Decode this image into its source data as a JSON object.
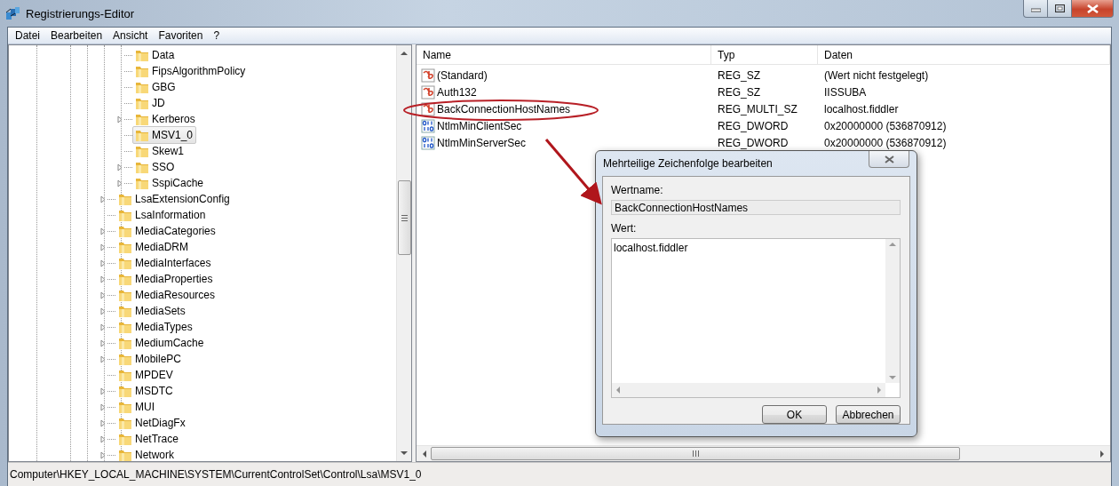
{
  "window": {
    "title": "Registrierungs-Editor"
  },
  "menu": [
    {
      "label": "Datei"
    },
    {
      "label": "Bearbeiten"
    },
    {
      "label": "Ansicht"
    },
    {
      "label": "Favoriten"
    },
    {
      "label": "?"
    }
  ],
  "tree": [
    {
      "children": [
        {
          "name": "Data",
          "expandable": false,
          "selected": false
        },
        {
          "name": "FipsAlgorithmPolicy",
          "expandable": false,
          "selected": false
        },
        {
          "name": "GBG",
          "expandable": false,
          "selected": false
        },
        {
          "name": "JD",
          "expandable": false,
          "selected": false
        },
        {
          "name": "Kerberos",
          "expandable": true,
          "selected": false
        },
        {
          "name": "MSV1_0",
          "expandable": false,
          "selected": true
        },
        {
          "name": "Skew1",
          "expandable": false,
          "selected": false
        },
        {
          "name": "SSO",
          "expandable": true,
          "selected": false
        },
        {
          "name": "SspiCache",
          "expandable": true,
          "selected": false
        }
      ]
    },
    {
      "name": "LsaExtensionConfig",
      "expandable": true,
      "selected": false
    },
    {
      "name": "LsaInformation",
      "expandable": false,
      "selected": false
    },
    {
      "name": "MediaCategories",
      "expandable": true,
      "selected": false
    },
    {
      "name": "MediaDRM",
      "expandable": true,
      "selected": false
    },
    {
      "name": "MediaInterfaces",
      "expandable": true,
      "selected": false
    },
    {
      "name": "MediaProperties",
      "expandable": true,
      "selected": false
    },
    {
      "name": "MediaResources",
      "expandable": true,
      "selected": false
    },
    {
      "name": "MediaSets",
      "expandable": true,
      "selected": false
    },
    {
      "name": "MediaTypes",
      "expandable": true,
      "selected": false
    },
    {
      "name": "MediumCache",
      "expandable": true,
      "selected": false
    },
    {
      "name": "MobilePC",
      "expandable": true,
      "selected": false
    },
    {
      "name": "MPDEV",
      "expandable": false,
      "selected": false
    },
    {
      "name": "MSDTC",
      "expandable": true,
      "selected": false
    },
    {
      "name": "MUI",
      "expandable": true,
      "selected": false
    },
    {
      "name": "NetDiagFx",
      "expandable": true,
      "selected": false
    },
    {
      "name": "NetTrace",
      "expandable": true,
      "selected": false
    },
    {
      "name": "Network",
      "expandable": true,
      "selected": false
    }
  ],
  "table": {
    "columns": [
      "Name",
      "Typ",
      "Daten"
    ],
    "rows": [
      {
        "kind": "string",
        "name": "(Standard)",
        "type": "REG_SZ",
        "data": "(Wert nicht festgelegt)"
      },
      {
        "kind": "string",
        "name": "Auth132",
        "type": "REG_SZ",
        "data": "IISSUBA"
      },
      {
        "kind": "string",
        "name": "BackConnectionHostNames",
        "type": "REG_MULTI_SZ",
        "data": "localhost.fiddler"
      },
      {
        "kind": "binary",
        "name": "NtlmMinClientSec",
        "type": "REG_DWORD",
        "data": "0x20000000 (536870912)"
      },
      {
        "kind": "binary",
        "name": "NtlmMinServerSec",
        "type": "REG_DWORD",
        "data": "0x20000000 (536870912)"
      }
    ]
  },
  "dialog": {
    "title": "Mehrteilige Zeichenfolge bearbeiten",
    "name_label": "Wertname:",
    "name_value": "BackConnectionHostNames",
    "value_label": "Wert:",
    "value": "localhost.fiddler",
    "buttons": [
      "OK",
      "Abbrechen"
    ]
  },
  "status_bar": "Computer\\HKEY_LOCAL_MACHINE\\SYSTEM\\CurrentControlSet\\Control\\Lsa\\MSV1_0"
}
